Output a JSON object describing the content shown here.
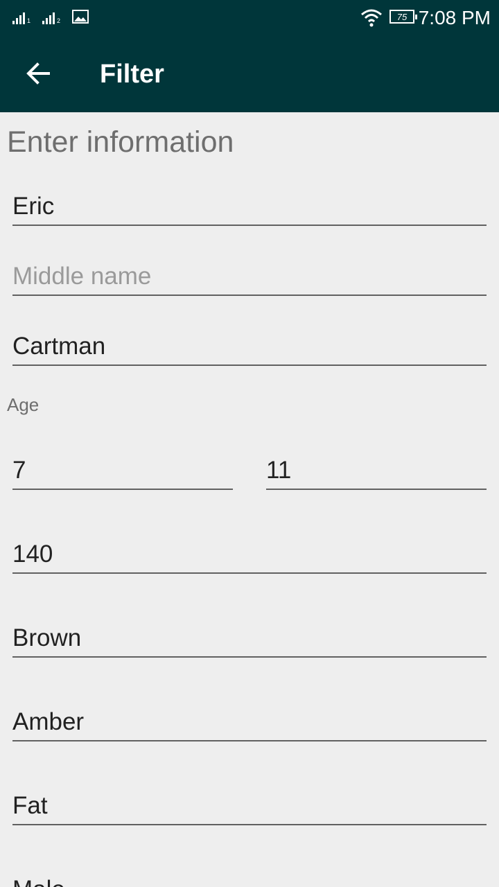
{
  "status_bar": {
    "sim1_label": "1",
    "sim2_label": "2",
    "battery_level": "75",
    "time": "7:08 PM",
    "icons": [
      "signal-sim1-icon",
      "signal-sim2-icon",
      "image-notification-icon",
      "wifi-icon",
      "battery-icon"
    ]
  },
  "app_bar": {
    "title": "Filter",
    "back_icon": "arrow-left-icon"
  },
  "form": {
    "heading": "Enter information",
    "first_name": "Eric",
    "middle_name_placeholder": "Middle name",
    "last_name": "Cartman",
    "age_label": "Age",
    "age_value_1": "7",
    "age_value_2": "11",
    "weight": "140",
    "hair_color": "Brown",
    "eye_color": "Amber",
    "body_type": "Fat",
    "gender": "Male"
  },
  "colors": {
    "app_bar": "#00363a",
    "background": "#eeeeee",
    "heading_text": "#6e6e6e",
    "field_text": "#212121",
    "placeholder_text": "#9a9a9a",
    "underline": "#606060"
  }
}
